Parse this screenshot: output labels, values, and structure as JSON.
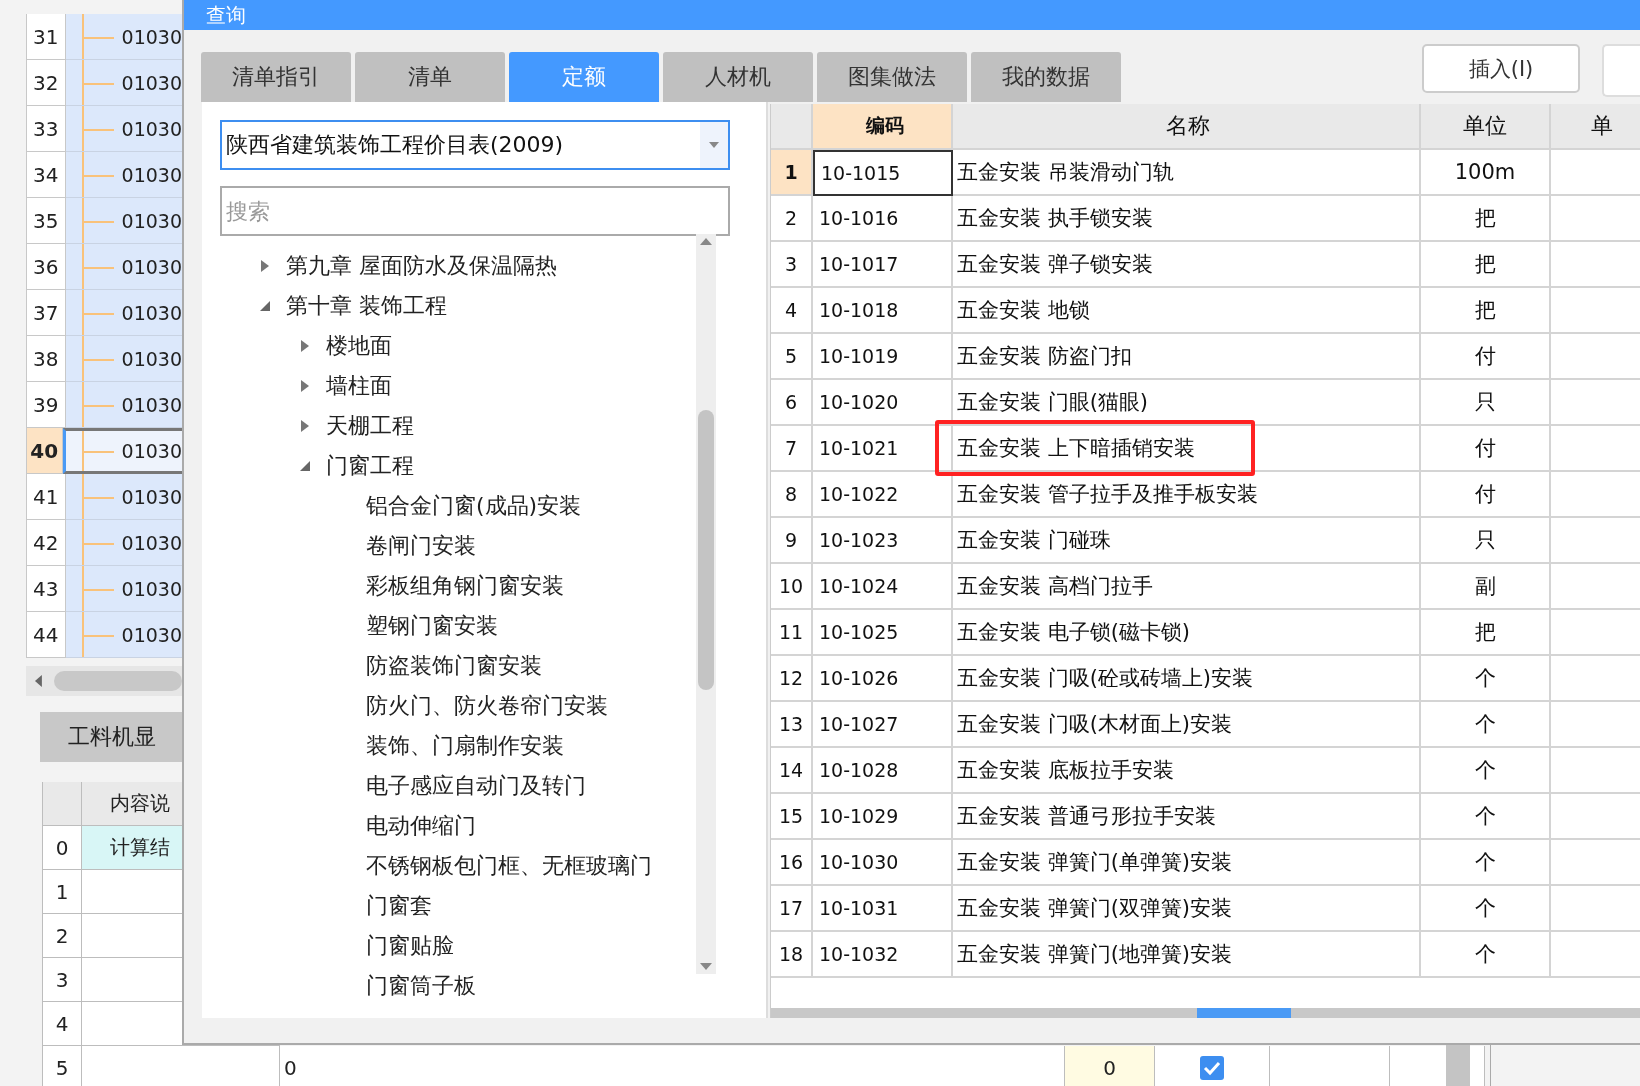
{
  "background": {
    "rows": [
      {
        "number": "31",
        "code": "01030",
        "selected": false
      },
      {
        "number": "32",
        "code": "01030",
        "selected": false
      },
      {
        "number": "33",
        "code": "01030",
        "selected": false
      },
      {
        "number": "34",
        "code": "01030",
        "selected": false
      },
      {
        "number": "35",
        "code": "01030",
        "selected": false
      },
      {
        "number": "36",
        "code": "01030",
        "selected": false
      },
      {
        "number": "37",
        "code": "01030",
        "selected": false
      },
      {
        "number": "38",
        "code": "01030",
        "selected": false
      },
      {
        "number": "39",
        "code": "01030",
        "selected": false
      },
      {
        "number": "40",
        "code": "01030",
        "selected": true
      },
      {
        "number": "41",
        "code": "01030",
        "selected": false
      },
      {
        "number": "42",
        "code": "01030",
        "selected": false
      },
      {
        "number": "43",
        "code": "01030",
        "selected": false
      },
      {
        "number": "44",
        "code": "01030",
        "selected": false
      }
    ],
    "detail_tab": "工料机显",
    "detail_grid": {
      "header": "内容说",
      "rows": [
        {
          "number": "0",
          "content": "计算结"
        },
        {
          "number": "1"
        },
        {
          "number": "2"
        },
        {
          "number": "3"
        },
        {
          "number": "4"
        },
        {
          "number": "5",
          "value": "0",
          "quantity": "0",
          "checked": true
        }
      ]
    }
  },
  "dialog": {
    "title": "查询",
    "tabs": [
      {
        "label": "清单指引",
        "selected": false
      },
      {
        "label": "清单",
        "selected": false
      },
      {
        "label": "定额",
        "selected": true
      },
      {
        "label": "人材机",
        "selected": false
      },
      {
        "label": "图集做法",
        "selected": false
      },
      {
        "label": "我的数据",
        "selected": false
      }
    ],
    "insert_button": "插入(I)",
    "library": "陕西省建筑装饰工程价目表(2009)",
    "search": {
      "placeholder": "搜索"
    },
    "tree": [
      {
        "label": "第九章 屋面防水及保温隔热",
        "expanded": false
      },
      {
        "label": "第十章 装饰工程",
        "expanded": true,
        "children": [
          {
            "label": "楼地面",
            "expanded": false
          },
          {
            "label": "墙柱面",
            "expanded": false
          },
          {
            "label": "天棚工程",
            "expanded": false
          },
          {
            "label": "门窗工程",
            "expanded": true,
            "children": [
              {
                "label": "铝合金门窗(成品)安装"
              },
              {
                "label": "卷闸门安装"
              },
              {
                "label": "彩板组角钢门窗安装"
              },
              {
                "label": "塑钢门窗安装"
              },
              {
                "label": "防盗装饰门窗安装"
              },
              {
                "label": "防火门、防火卷帘门安装"
              },
              {
                "label": "装饰、门扇制作安装"
              },
              {
                "label": "电子感应自动门及转门"
              },
              {
                "label": "电动伸缩门"
              },
              {
                "label": "不锈钢板包门框、无框玻璃门"
              },
              {
                "label": "门窗套"
              },
              {
                "label": "门窗贴脸"
              },
              {
                "label": "门窗筒子板"
              }
            ]
          }
        ]
      }
    ],
    "table": {
      "columns": [
        "编码",
        "名称",
        "单位",
        "单"
      ],
      "rows": [
        {
          "number": "1",
          "code": "10-1015",
          "name": "五金安装 吊装滑动门轨",
          "unit": "100m",
          "selected": true,
          "highlighted": false
        },
        {
          "number": "2",
          "code": "10-1016",
          "name": "五金安装 执手锁安装",
          "unit": "把",
          "selected": false,
          "highlighted": false
        },
        {
          "number": "3",
          "code": "10-1017",
          "name": "五金安装 弹子锁安装",
          "unit": "把",
          "selected": false,
          "highlighted": false
        },
        {
          "number": "4",
          "code": "10-1018",
          "name": "五金安装 地锁",
          "unit": "把",
          "selected": false,
          "highlighted": false
        },
        {
          "number": "5",
          "code": "10-1019",
          "name": "五金安装 防盗门扣",
          "unit": "付",
          "selected": false,
          "highlighted": false
        },
        {
          "number": "6",
          "code": "10-1020",
          "name": "五金安装 门眼(猫眼)",
          "unit": "只",
          "selected": false,
          "highlighted": false
        },
        {
          "number": "7",
          "code": "10-1021",
          "name": "五金安装 上下暗插销安装",
          "unit": "付",
          "selected": false,
          "highlighted": true
        },
        {
          "number": "8",
          "code": "10-1022",
          "name": "五金安装 管子拉手及推手板安装",
          "unit": "付",
          "selected": false,
          "highlighted": false
        },
        {
          "number": "9",
          "code": "10-1023",
          "name": "五金安装 门碰珠",
          "unit": "只",
          "selected": false,
          "highlighted": false
        },
        {
          "number": "10",
          "code": "10-1024",
          "name": "五金安装 高档门拉手",
          "unit": "副",
          "selected": false,
          "highlighted": false
        },
        {
          "number": "11",
          "code": "10-1025",
          "name": "五金安装 电子锁(磁卡锁)",
          "unit": "把",
          "selected": false,
          "highlighted": false
        },
        {
          "number": "12",
          "code": "10-1026",
          "name": "五金安装 门吸(砼或砖墙上)安装",
          "unit": "个",
          "selected": false,
          "highlighted": false
        },
        {
          "number": "13",
          "code": "10-1027",
          "name": "五金安装 门吸(木材面上)安装",
          "unit": "个",
          "selected": false,
          "highlighted": false
        },
        {
          "number": "14",
          "code": "10-1028",
          "name": "五金安装 底板拉手安装",
          "unit": "个",
          "selected": false,
          "highlighted": false
        },
        {
          "number": "15",
          "code": "10-1029",
          "name": "五金安装 普通弓形拉手安装",
          "unit": "个",
          "selected": false,
          "highlighted": false
        },
        {
          "number": "16",
          "code": "10-1030",
          "name": "五金安装 弹簧门(单弹簧)安装",
          "unit": "个",
          "selected": false,
          "highlighted": false
        },
        {
          "number": "17",
          "code": "10-1031",
          "name": "五金安装 弹簧门(双弹簧)安装",
          "unit": "个",
          "selected": false,
          "highlighted": false
        },
        {
          "number": "18",
          "code": "10-1032",
          "name": "五金安装 弹簧门(地弹簧)安装",
          "unit": "个",
          "selected": false,
          "highlighted": false
        }
      ]
    }
  }
}
